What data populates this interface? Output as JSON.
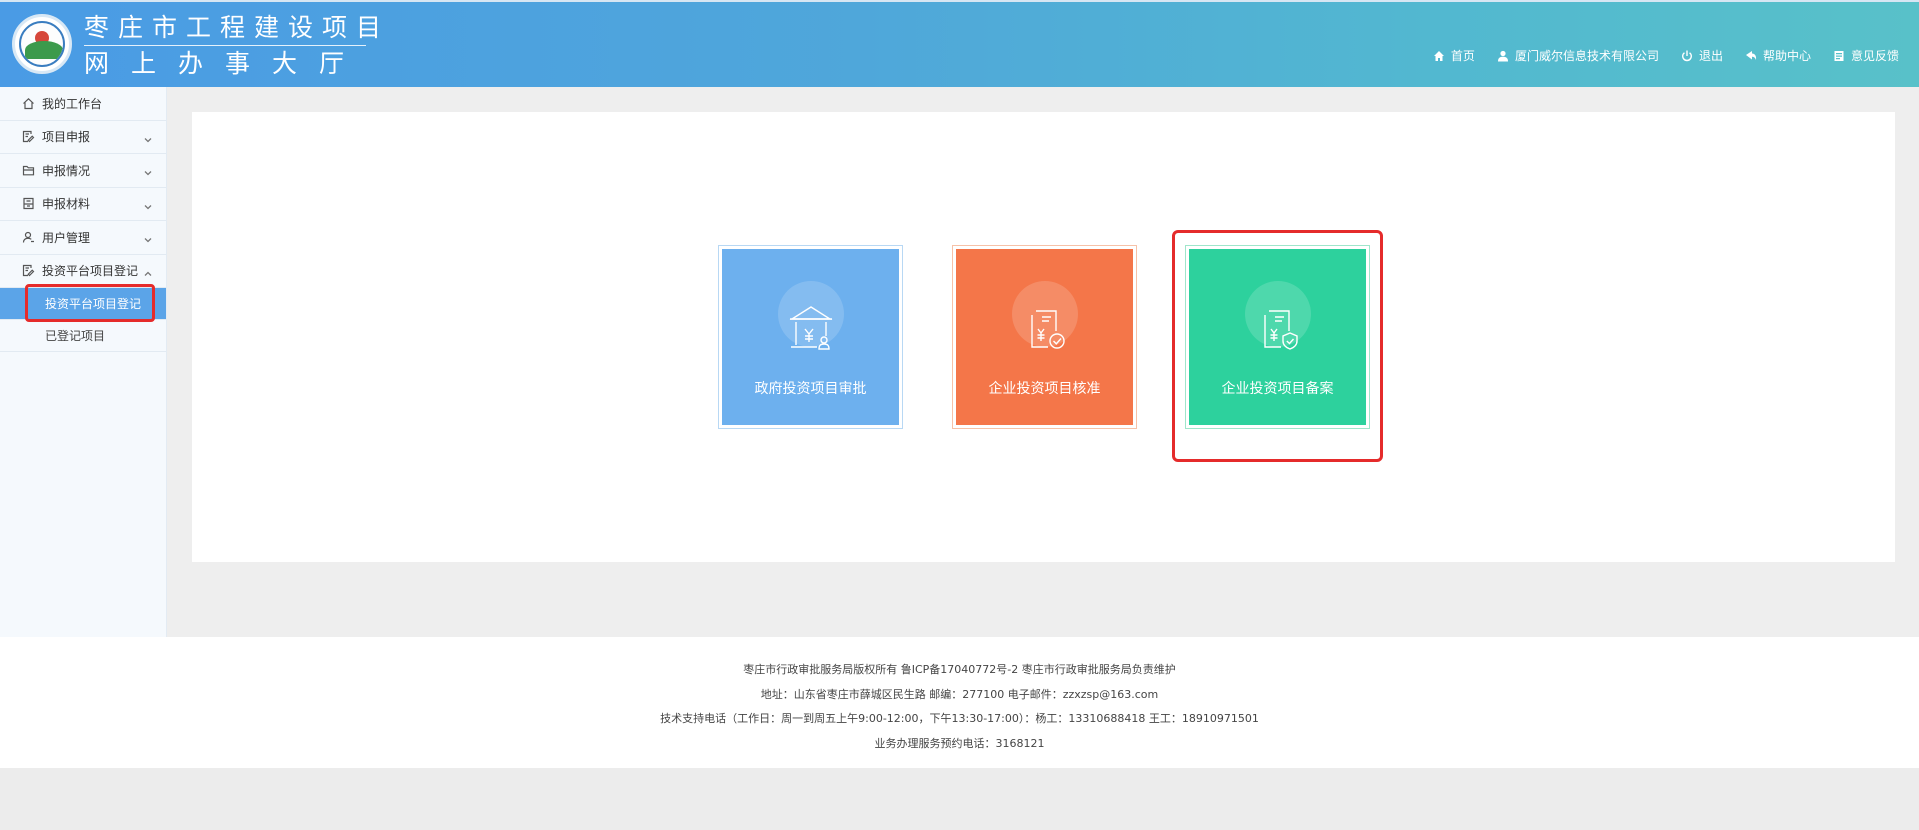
{
  "header": {
    "title_line1": "枣庄市工程建设项目",
    "title_line2": "网上办事大厅",
    "logo_icon": "city-seal-logo",
    "nav": [
      {
        "label": "首页",
        "icon": "home-icon"
      },
      {
        "label": "厦门威尔信息技术有限公司",
        "icon": "user-icon"
      },
      {
        "label": "退出",
        "icon": "power-icon"
      },
      {
        "label": "帮助中心",
        "icon": "help-icon"
      },
      {
        "label": "意见反馈",
        "icon": "feedback-icon"
      }
    ]
  },
  "sidebar": {
    "items": [
      {
        "label": "我的工作台",
        "icon": "home-icon",
        "chevron": "none"
      },
      {
        "label": "项目申报",
        "icon": "edit-doc-icon",
        "chevron": "down"
      },
      {
        "label": "申报情况",
        "icon": "folder-icon",
        "chevron": "down"
      },
      {
        "label": "申报材料",
        "icon": "archive-icon",
        "chevron": "down"
      },
      {
        "label": "用户管理",
        "icon": "user-icon",
        "chevron": "down"
      },
      {
        "label": "投资平台项目登记",
        "icon": "edit-doc-icon",
        "chevron": "up"
      }
    ],
    "subitems": [
      {
        "label": "投资平台项目登记",
        "active": true
      },
      {
        "label": "已登记项目",
        "active": false
      }
    ]
  },
  "cards": [
    {
      "label": "政府投资项目审批",
      "color": "#6db0ee",
      "icon": "government-building-icon"
    },
    {
      "label": "企业投资项目核准",
      "color": "#f47649",
      "icon": "document-check-icon"
    },
    {
      "label": "企业投资项目备案",
      "color": "#2dd19d",
      "icon": "document-shield-icon"
    }
  ],
  "footer": {
    "line1": "枣庄市行政审批服务局版权所有  鲁ICP备17040772号-2  枣庄市行政审批服务局负责维护",
    "line2": "地址：山东省枣庄市薛城区民生路 邮编：277100 电子邮件：zzxzsp@163.com",
    "line3": "技术支持电话（工作日：周一到周五上午9:00-12:00，下午13:30-17:00）：杨工：13310688418  王工：18910971501",
    "line4": "业务办理服务预约电话：3168121"
  },
  "colors": {
    "header_start": "#4a9be5",
    "header_end": "#58c1c9",
    "active_menu": "#5ba4e8",
    "highlight_red": "#e52b2b"
  }
}
